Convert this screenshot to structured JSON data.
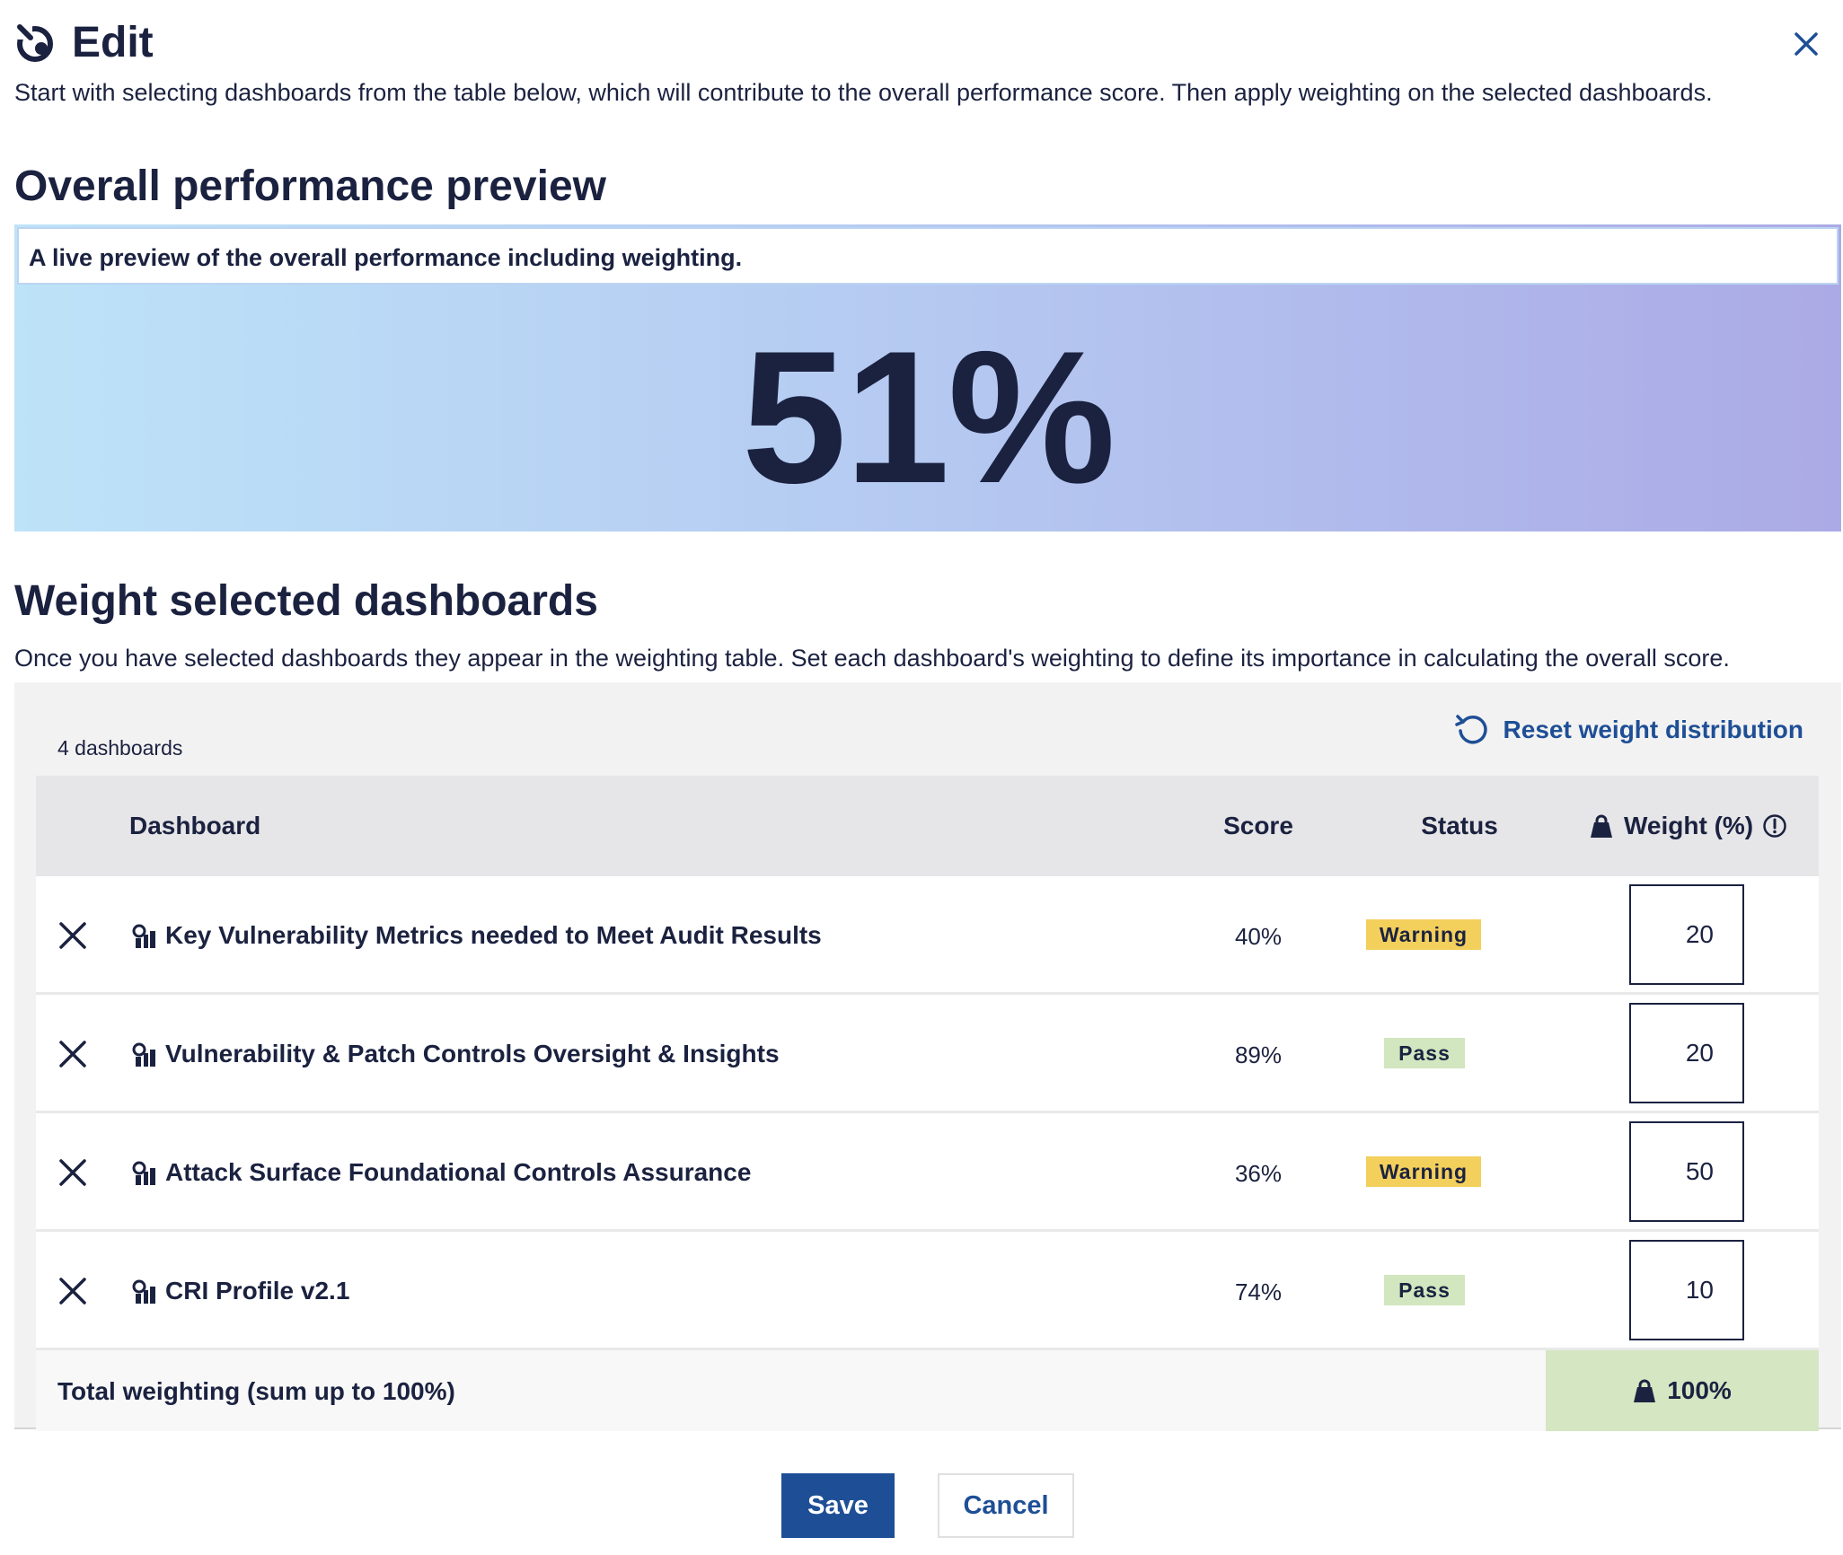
{
  "header": {
    "title": "Edit",
    "logo_icon": "logo-icon",
    "close_icon": "close-icon"
  },
  "intro": "Start with selecting dashboards from the table below, which will contribute to the overall performance score. Then apply weighting on the selected dashboards.",
  "preview": {
    "heading": "Overall performance preview",
    "caption": "A live preview of the overall performance including weighting.",
    "value": "51%"
  },
  "weighting": {
    "heading": "Weight selected dashboards",
    "description": "Once you have selected dashboards they appear in the weighting table. Set each dashboard's weighting to define its importance in calculating the overall score.",
    "count": "4 dashboards",
    "reset_label": "Reset weight distribution",
    "columns": {
      "dashboard": "Dashboard",
      "score": "Score",
      "status": "Status",
      "weight": "Weight (%)"
    },
    "rows": [
      {
        "name": "Key Vulnerability Metrics needed to Meet Audit Results",
        "score": "40%",
        "status": "Warning",
        "weight": "20"
      },
      {
        "name": "Vulnerability & Patch Controls Oversight & Insights",
        "score": "89%",
        "status": "Pass",
        "weight": "20"
      },
      {
        "name": "Attack Surface Foundational Controls Assurance",
        "score": "36%",
        "status": "Warning",
        "weight": "50"
      },
      {
        "name": "CRI Profile v2.1",
        "score": "74%",
        "status": "Pass",
        "weight": "10"
      }
    ],
    "total_label": "Total weighting (sum up to 100%)",
    "total_value": "100%"
  },
  "actions": {
    "save": "Save",
    "cancel": "Cancel"
  },
  "colors": {
    "primary": "#1e4f96",
    "text": "#1b2240",
    "warning": "#f3cf5c",
    "pass": "#d2e6bf",
    "total_bg": "#d5e6c3"
  }
}
